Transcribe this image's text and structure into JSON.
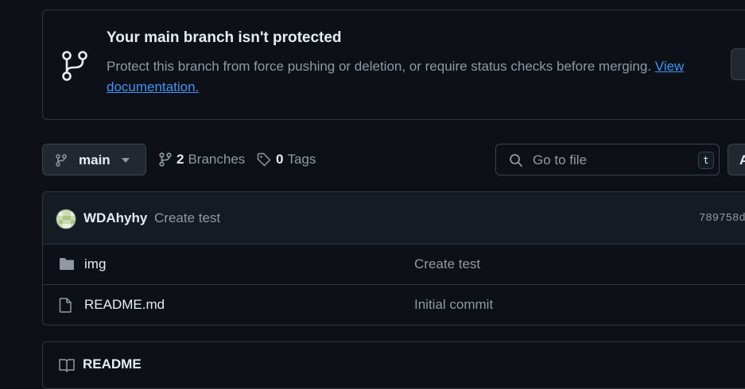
{
  "banner": {
    "title": "Your main branch isn't protected",
    "text": "Protect this branch from force pushing or deletion, or require status checks before merging. ",
    "link": "View documentation."
  },
  "toolbar": {
    "branch": "main",
    "branches_count": "2",
    "branches_label": "Branches",
    "tags_count": "0",
    "tags_label": "Tags",
    "search_placeholder": "Go to file",
    "search_shortcut": "t",
    "add_label": "A"
  },
  "latest_commit": {
    "author": "WDAhyhy",
    "message": "Create test",
    "hash": "789758d"
  },
  "files": [
    {
      "name": "img",
      "type": "folder",
      "commit_message": "Create test"
    },
    {
      "name": "README.md",
      "type": "file",
      "commit_message": "Initial commit"
    }
  ],
  "readme": {
    "title": "README"
  },
  "colors": {
    "background": "#0d1117",
    "link": "#4493f8",
    "muted": "#9198a1",
    "border": "#30363d"
  }
}
